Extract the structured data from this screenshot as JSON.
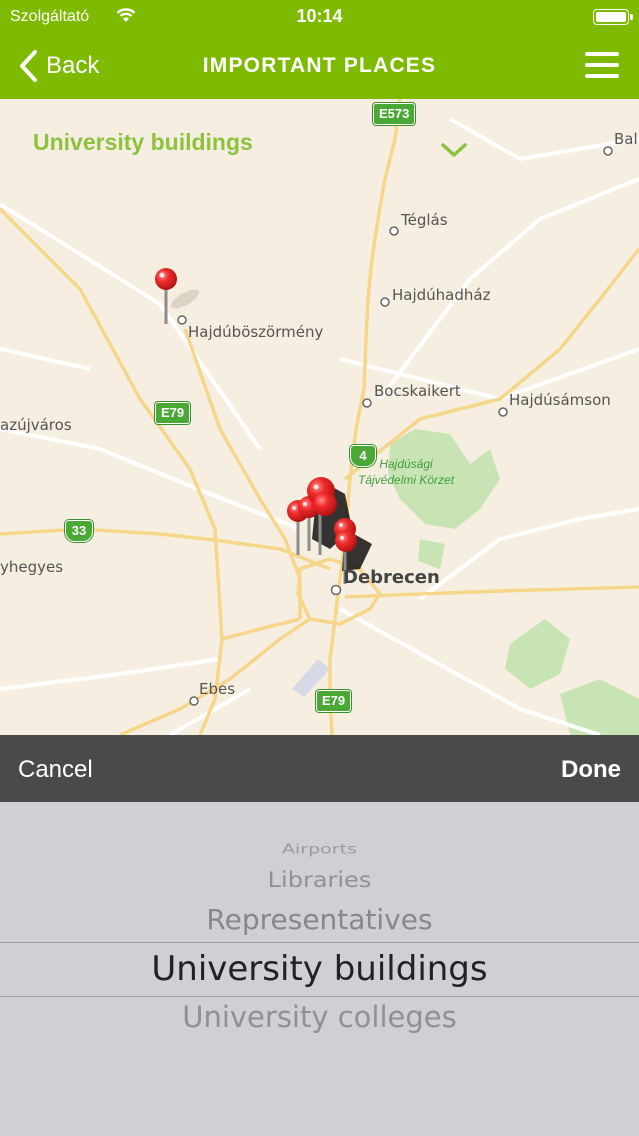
{
  "status_bar": {
    "carrier": "Szolgáltató",
    "time": "10:14"
  },
  "nav": {
    "back_label": "Back",
    "title": "IMPORTANT PLACES"
  },
  "map": {
    "category_title": "University buildings",
    "places": {
      "bal": "Bal",
      "teglas": "Téglás",
      "hajduhadhaz": "Hajdúhadház",
      "hajduboszormeny": "Hajdúböszörmény",
      "bocskaikert": "Bocskaikert",
      "hajdusamson": "Hajdúsámson",
      "hajdunanas_partial": "azújváros",
      "nyiregyhaza_partial": "yhegyes",
      "debrecen": "Debrecen",
      "ebes": "Ebes"
    },
    "park_label_line1": "Hajdúsági",
    "park_label_line2": "Tájvédelmi Körzet",
    "road_shields": {
      "e573": "E573",
      "e79_north": "E79",
      "r4": "4",
      "r33": "33",
      "e79_south": "E79"
    }
  },
  "picker_toolbar": {
    "cancel_label": "Cancel",
    "done_label": "Done"
  },
  "picker": {
    "options": [
      "Airports",
      "Libraries",
      "Representatives",
      "University buildings",
      "University colleges"
    ],
    "selected": "University buildings"
  }
}
